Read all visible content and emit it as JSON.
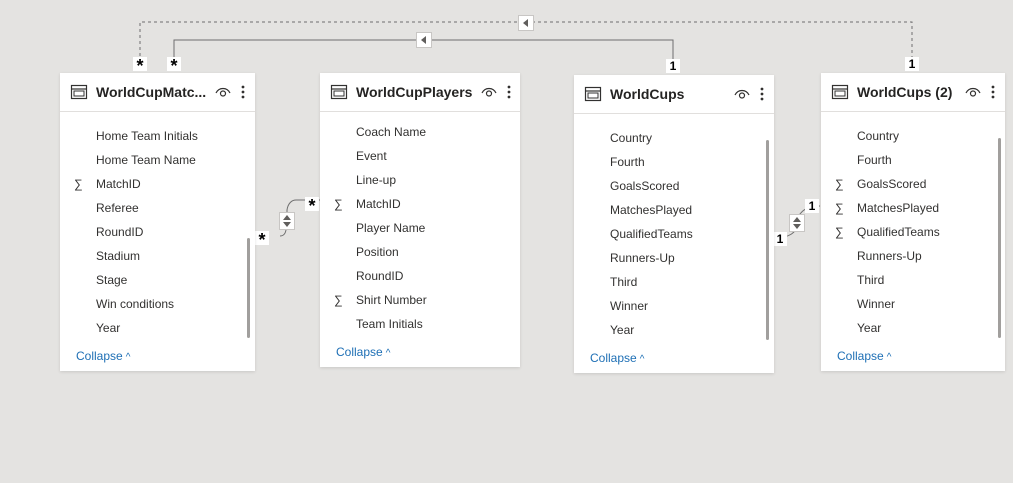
{
  "tables": [
    {
      "title": "WorldCupMatc...",
      "fields": [
        {
          "name": "Home Team Initials",
          "sum": false
        },
        {
          "name": "Home Team Name",
          "sum": false
        },
        {
          "name": "MatchID",
          "sum": true
        },
        {
          "name": "Referee",
          "sum": false
        },
        {
          "name": "RoundID",
          "sum": false
        },
        {
          "name": "Stadium",
          "sum": false
        },
        {
          "name": "Stage",
          "sum": false
        },
        {
          "name": "Win conditions",
          "sum": false
        },
        {
          "name": "Year",
          "sum": false
        }
      ],
      "collapse_label": "Collapse"
    },
    {
      "title": "WorldCupPlayers",
      "fields": [
        {
          "name": "Coach Name",
          "sum": false
        },
        {
          "name": "Event",
          "sum": false
        },
        {
          "name": "Line-up",
          "sum": false
        },
        {
          "name": "MatchID",
          "sum": true
        },
        {
          "name": "Player Name",
          "sum": false
        },
        {
          "name": "Position",
          "sum": false
        },
        {
          "name": "RoundID",
          "sum": false
        },
        {
          "name": "Shirt Number",
          "sum": true
        },
        {
          "name": "Team Initials",
          "sum": false
        }
      ],
      "collapse_label": "Collapse"
    },
    {
      "title": "WorldCups",
      "fields": [
        {
          "name": "Country",
          "sum": false
        },
        {
          "name": "Fourth",
          "sum": false
        },
        {
          "name": "GoalsScored",
          "sum": false
        },
        {
          "name": "MatchesPlayed",
          "sum": false
        },
        {
          "name": "QualifiedTeams",
          "sum": false
        },
        {
          "name": "Runners-Up",
          "sum": false
        },
        {
          "name": "Third",
          "sum": false
        },
        {
          "name": "Winner",
          "sum": false
        },
        {
          "name": "Year",
          "sum": false
        }
      ],
      "collapse_label": "Collapse"
    },
    {
      "title": "WorldCups (2)",
      "fields": [
        {
          "name": "Country",
          "sum": false
        },
        {
          "name": "Fourth",
          "sum": false
        },
        {
          "name": "GoalsScored",
          "sum": true
        },
        {
          "name": "MatchesPlayed",
          "sum": true
        },
        {
          "name": "QualifiedTeams",
          "sum": true
        },
        {
          "name": "Runners-Up",
          "sum": false
        },
        {
          "name": "Third",
          "sum": false
        },
        {
          "name": "Winner",
          "sum": false
        },
        {
          "name": "Year",
          "sum": false
        }
      ],
      "collapse_label": "Collapse"
    }
  ],
  "relationships": [
    {
      "from": "WorldCupMatc...",
      "from_cardinality": "*",
      "to": "WorldCups (2)",
      "to_cardinality": "1",
      "style": "dashed"
    },
    {
      "from": "WorldCupMatc...",
      "from_cardinality": "*",
      "to": "WorldCups",
      "to_cardinality": "1",
      "style": "solid"
    },
    {
      "from": "WorldCupMatc...",
      "from_cardinality": "*",
      "to": "WorldCupPlayers",
      "to_cardinality": "*",
      "style": "solid"
    },
    {
      "from": "WorldCups",
      "from_cardinality": "1",
      "to": "WorldCups (2)",
      "to_cardinality": "1",
      "style": "solid"
    }
  ],
  "symbols": {
    "sigma": "∑",
    "many": "*",
    "one": "1"
  },
  "colors": {
    "canvas": "#e4e3e1",
    "link": "#1e6fb5",
    "line": "#6e6e6e"
  }
}
